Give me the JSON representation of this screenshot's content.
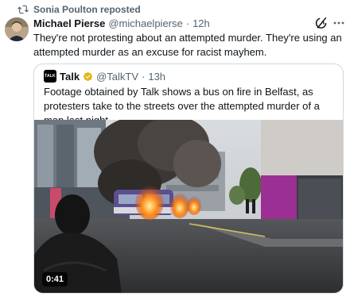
{
  "repost": {
    "label": "Sonia Poulton reposted"
  },
  "tweet": {
    "author_name": "Michael Pierse",
    "author_handle": "@michaelpierse",
    "separator": "·",
    "time": "12h",
    "text": "They're not protesting about an attempted murder. They're using an attempted murder as an excuse for racist mayhem."
  },
  "quote": {
    "logo_text": "TALK",
    "author_name": "Talk",
    "author_handle": "@TalkTV",
    "separator": "·",
    "time": "13h",
    "text": "Footage obtained by Talk shows a bus on fire in Belfast, as protesters take to the streets over the attempted murder of a man last night.",
    "video_duration": "0:41"
  },
  "colors": {
    "text_primary": "#0f1419",
    "text_secondary": "#536471",
    "border": "#cfd9de",
    "verified_gold": "#e2b719"
  },
  "icons": [
    "repost-icon",
    "grok-icon",
    "more-icon",
    "verified-badge-icon"
  ]
}
